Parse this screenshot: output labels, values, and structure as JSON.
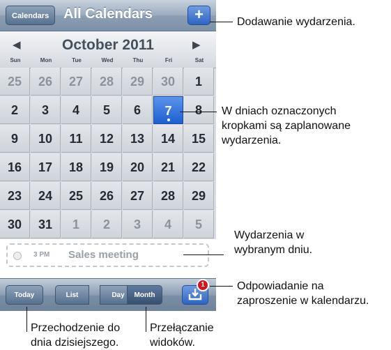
{
  "navbar": {
    "calendars_label": "Calendars",
    "title": "All Calendars",
    "add_label": "+"
  },
  "month": {
    "title": "October 2011",
    "prev_icon": "left-triangle-icon",
    "next_icon": "right-triangle-icon",
    "weekdays": [
      "Sun",
      "Mon",
      "Tue",
      "Wed",
      "Thu",
      "Fri",
      "Sat"
    ]
  },
  "calendar": {
    "weeks": [
      [
        {
          "d": "25",
          "m": "prev"
        },
        {
          "d": "26",
          "m": "prev"
        },
        {
          "d": "27",
          "m": "prev"
        },
        {
          "d": "28",
          "m": "prev"
        },
        {
          "d": "29",
          "m": "prev"
        },
        {
          "d": "30",
          "m": "prev"
        },
        {
          "d": "1",
          "m": "cur"
        }
      ],
      [
        {
          "d": "2",
          "m": "cur"
        },
        {
          "d": "3",
          "m": "cur"
        },
        {
          "d": "4",
          "m": "cur"
        },
        {
          "d": "5",
          "m": "cur"
        },
        {
          "d": "6",
          "m": "cur"
        },
        {
          "d": "7",
          "m": "cur",
          "selected": true,
          "has_event": true
        },
        {
          "d": "8",
          "m": "cur"
        }
      ],
      [
        {
          "d": "9",
          "m": "cur"
        },
        {
          "d": "10",
          "m": "cur"
        },
        {
          "d": "11",
          "m": "cur"
        },
        {
          "d": "12",
          "m": "cur"
        },
        {
          "d": "13",
          "m": "cur"
        },
        {
          "d": "14",
          "m": "cur"
        },
        {
          "d": "15",
          "m": "cur"
        }
      ],
      [
        {
          "d": "16",
          "m": "cur"
        },
        {
          "d": "17",
          "m": "cur"
        },
        {
          "d": "18",
          "m": "cur"
        },
        {
          "d": "19",
          "m": "cur"
        },
        {
          "d": "20",
          "m": "cur"
        },
        {
          "d": "21",
          "m": "cur"
        },
        {
          "d": "22",
          "m": "cur"
        }
      ],
      [
        {
          "d": "23",
          "m": "cur"
        },
        {
          "d": "24",
          "m": "cur"
        },
        {
          "d": "25",
          "m": "cur"
        },
        {
          "d": "26",
          "m": "cur"
        },
        {
          "d": "27",
          "m": "cur"
        },
        {
          "d": "28",
          "m": "cur"
        },
        {
          "d": "29",
          "m": "cur"
        }
      ],
      [
        {
          "d": "30",
          "m": "cur"
        },
        {
          "d": "31",
          "m": "cur"
        },
        {
          "d": "1",
          "m": "next"
        },
        {
          "d": "2",
          "m": "next"
        },
        {
          "d": "3",
          "m": "next"
        },
        {
          "d": "4",
          "m": "next"
        },
        {
          "d": "5",
          "m": "next"
        }
      ]
    ]
  },
  "event": {
    "time": "3 PM",
    "title": "Sales meeting"
  },
  "toolbar": {
    "today_label": "Today",
    "view_tabs": [
      "List",
      "Day",
      "Month"
    ],
    "active_tab": "Month",
    "inbox_icon": "inbox-tray-icon",
    "badge_count": "1"
  },
  "callouts": {
    "add_event": "Dodawanie wydarzenia.",
    "dots": "W dniach oznaczonych kropkami są zaplanowane wydarzenia.",
    "day_events": "Wydarzenia w wybranym dniu.",
    "invitation": "Odpowiadanie na zaproszenie w kalendarzu.",
    "today": "Przechodzenie do dnia dzisiejszego.",
    "views": "Przełączanie widoków."
  },
  "colors": {
    "selected_day": "#1d5fd0",
    "badge": "#d4131b",
    "navbar": "#8c9eb3"
  }
}
